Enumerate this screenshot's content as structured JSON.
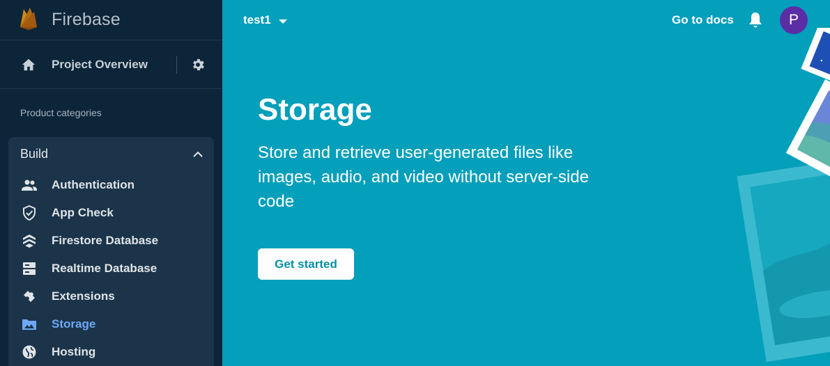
{
  "app": {
    "brand_name": "Firebase"
  },
  "sidebar": {
    "overview_label": "Project Overview",
    "category_label": "Product categories",
    "build": {
      "title": "Build",
      "items": [
        {
          "label": "Authentication",
          "icon": "people-icon"
        },
        {
          "label": "App Check",
          "icon": "shield-check-icon"
        },
        {
          "label": "Firestore Database",
          "icon": "firestore-icon"
        },
        {
          "label": "Realtime Database",
          "icon": "database-icon"
        },
        {
          "label": "Extensions",
          "icon": "puzzle-icon"
        },
        {
          "label": "Storage",
          "icon": "photo-icon",
          "active": true
        },
        {
          "label": "Hosting",
          "icon": "globe-icon"
        }
      ]
    }
  },
  "topbar": {
    "project_name": "test1",
    "docs_label": "Go to docs",
    "avatar_initial": "P"
  },
  "hero": {
    "title": "Storage",
    "description": "Store and retrieve user-generated files like images, audio, and video without server-side code",
    "cta_label": "Get started"
  },
  "colors": {
    "sidebar_bg": "#0d2539",
    "main_bg": "#039fbb",
    "active_nav": "#6fa8f7",
    "avatar_bg": "#5b2ea6"
  }
}
